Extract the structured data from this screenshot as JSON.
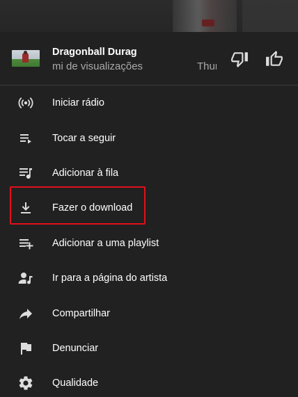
{
  "song": {
    "title": "Dragonball Durag",
    "views": "mi de visualizações",
    "artist": "Thundercat",
    "thumbnail_icon": "video-thumbnail"
  },
  "actions": {
    "dislike_icon": "thumb-down-icon",
    "like_icon": "thumb-up-icon"
  },
  "menu": {
    "items": [
      {
        "label": "Iniciar rádio",
        "icon": "radio-icon"
      },
      {
        "label": "Tocar a seguir",
        "icon": "play-next-icon"
      },
      {
        "label": "Adicionar à fila",
        "icon": "add-to-queue-icon"
      },
      {
        "label": "Fazer o download",
        "icon": "download-icon"
      },
      {
        "label": "Adicionar a uma playlist",
        "icon": "playlist-add-icon"
      },
      {
        "label": "Ir para a página do artista",
        "icon": "artist-icon"
      },
      {
        "label": "Compartilhar",
        "icon": "share-icon"
      },
      {
        "label": "Denunciar",
        "icon": "flag-icon"
      },
      {
        "label": "Qualidade",
        "icon": "gear-icon"
      }
    ],
    "highlighted_index": 3
  },
  "colors": {
    "background": "#212121",
    "text_primary": "#ffffff",
    "text_secondary": "#aaaaaa",
    "highlight": "#e3101b",
    "icon": "#dddddd"
  }
}
